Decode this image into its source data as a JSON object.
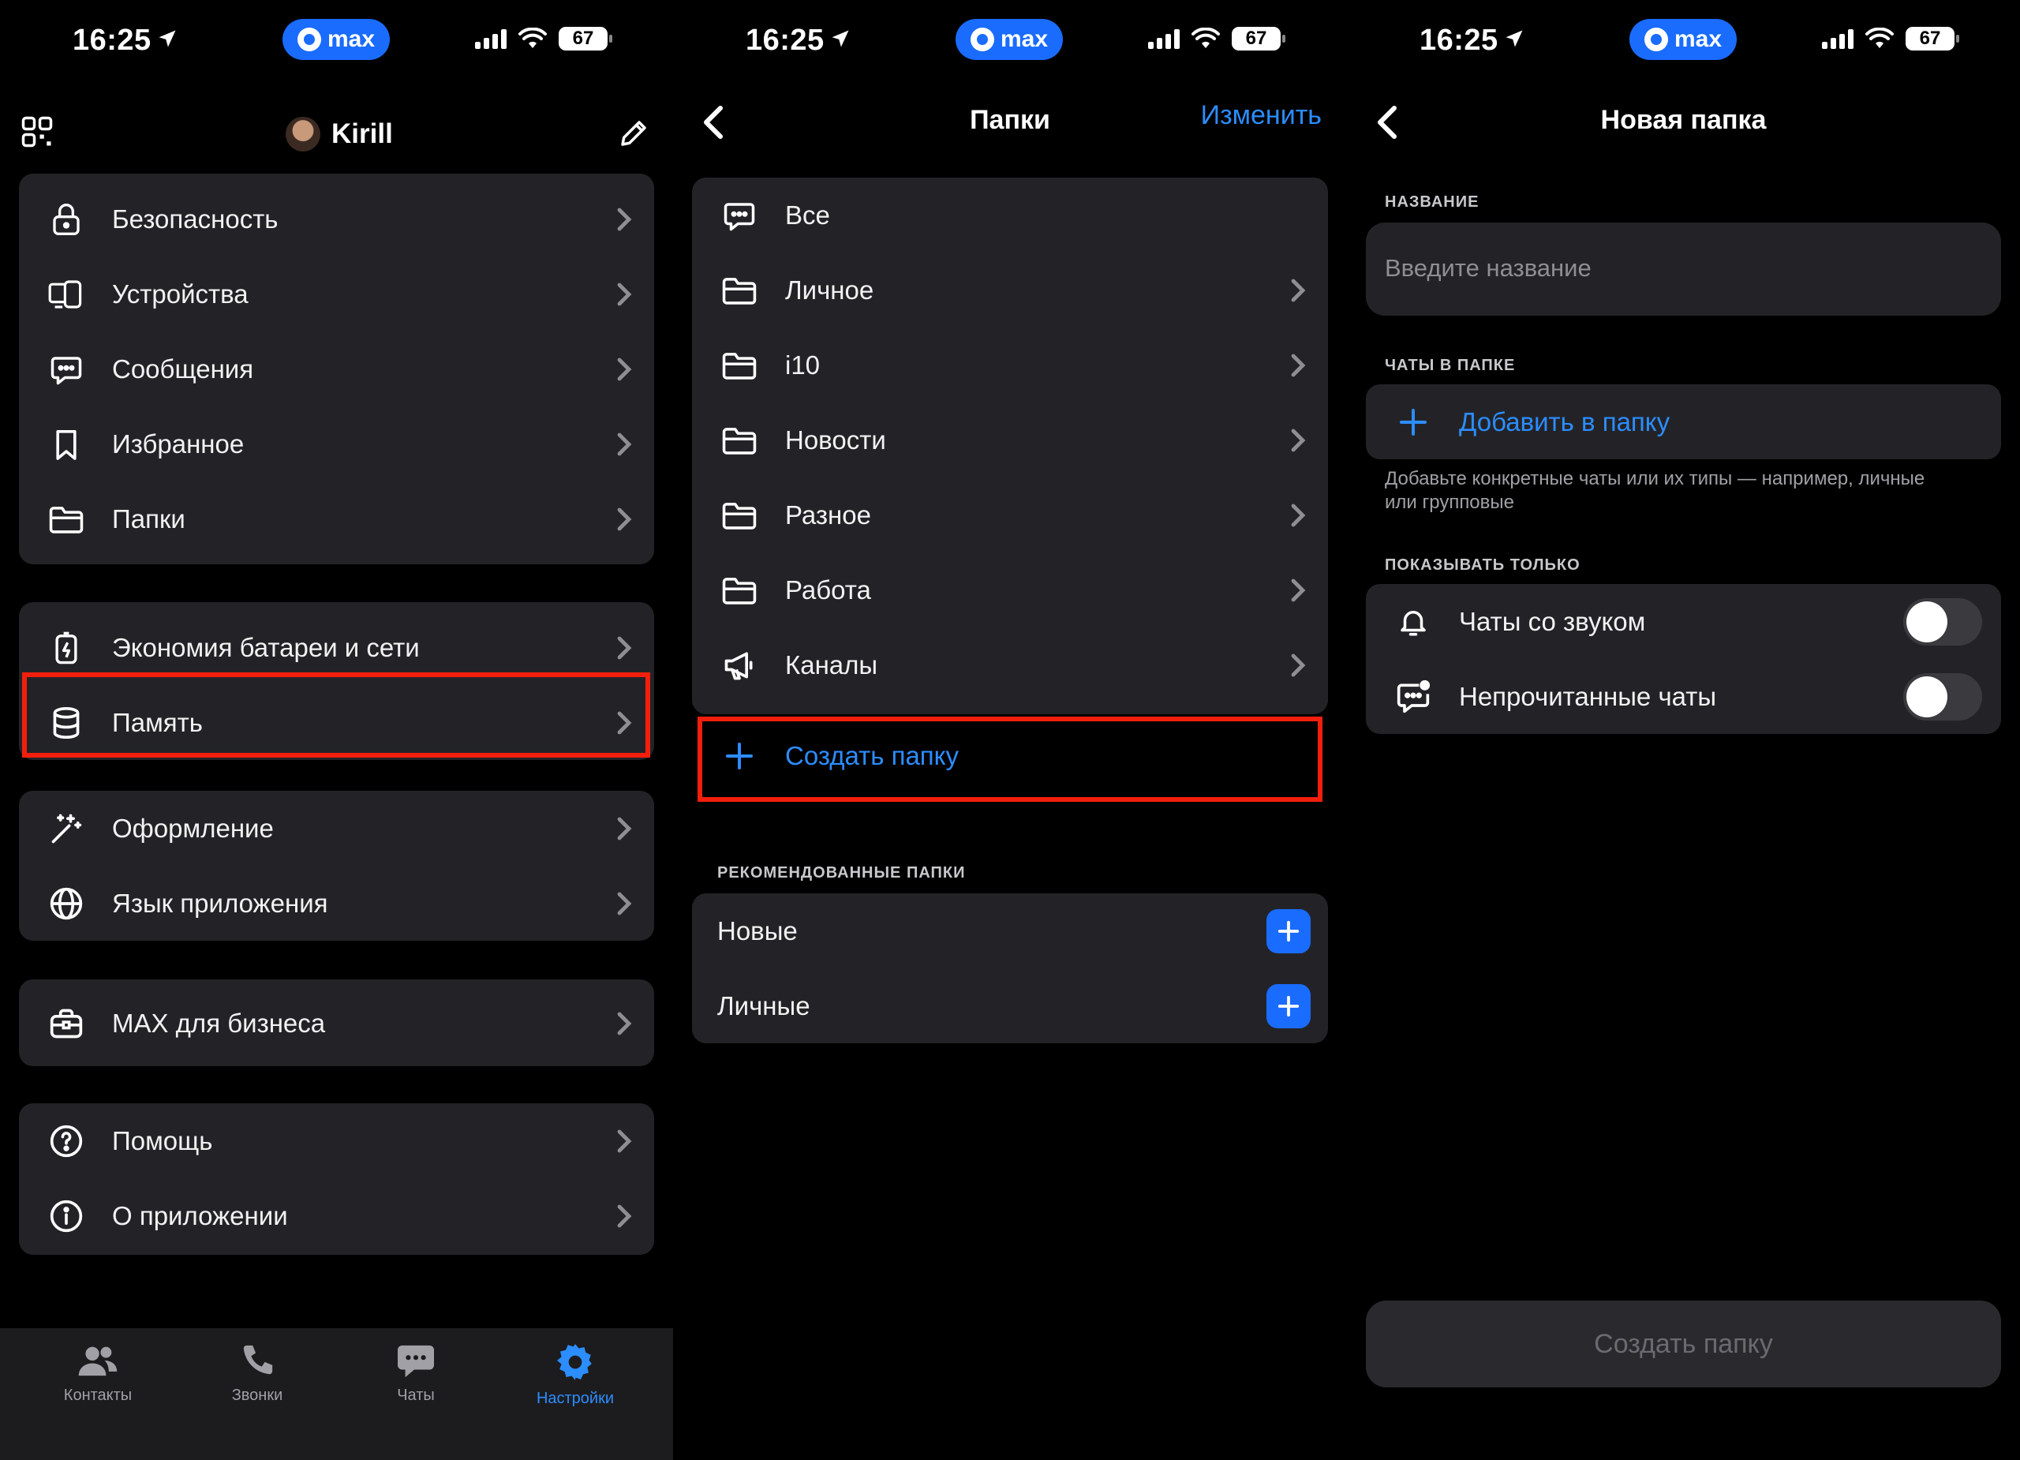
{
  "status_bar": {
    "time": "16:25",
    "badge": "max",
    "battery": "67"
  },
  "settings": {
    "profile_name": "Kirill",
    "group1": [
      "Безопасность",
      "Устройства",
      "Сообщения",
      "Избранное",
      "Папки"
    ],
    "group2": [
      "Экономия батареи и сети",
      "Память"
    ],
    "group3": [
      "Оформление",
      "Язык приложения"
    ],
    "group4": [
      "MAX для бизнеса"
    ],
    "group5": [
      "Помощь",
      "О приложении"
    ],
    "tabs": [
      "Контакты",
      "Звонки",
      "Чаты",
      "Настройки"
    ]
  },
  "folders": {
    "title": "Папки",
    "edit": "Изменить",
    "items": [
      "Все",
      "Личное",
      "i10",
      "Новости",
      "Разное",
      "Работа",
      "Каналы"
    ],
    "create": "Создать папку",
    "recommended_label": "РЕКОМЕНДОВАННЫЕ ПАПКИ",
    "recommended": [
      "Новые",
      "Личные"
    ]
  },
  "new_folder": {
    "title": "Новая папка",
    "name_label": "НАЗВАНИЕ",
    "name_placeholder": "Введите название",
    "chats_label": "ЧАТЫ В ПАПКЕ",
    "add_to_folder": "Добавить в папку",
    "hint": "Добавьте конкретные чаты или их типы — например, личные или групповые",
    "show_only_label": "ПОКАЗЫВАТЬ ТОЛЬКО",
    "toggles": [
      "Чаты со звуком",
      "Непрочитанные чаты"
    ],
    "create_button": "Создать папку"
  },
  "colors": {
    "accent": "#2c8dff",
    "highlight": "#f21f0c",
    "card": "#232327"
  }
}
